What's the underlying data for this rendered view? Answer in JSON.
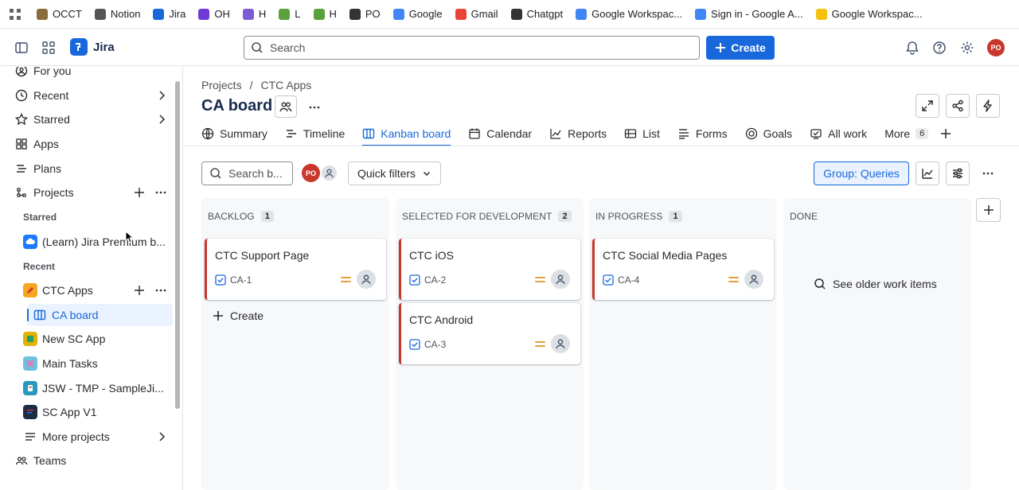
{
  "bookmarks": [
    {
      "label": "OCCT",
      "color": "#8b6a3e"
    },
    {
      "label": "Notion",
      "color": "#555555"
    },
    {
      "label": "Jira",
      "color": "#1868db"
    },
    {
      "label": "OH",
      "color": "#6f3bd6"
    },
    {
      "label": "H",
      "color": "#7b5cd6"
    },
    {
      "label": "L",
      "color": "#5aa13c"
    },
    {
      "label": "H",
      "color": "#5aa13c"
    },
    {
      "label": "PO",
      "color": "#333333"
    },
    {
      "label": "Google",
      "color": "#4285f4"
    },
    {
      "label": "Gmail",
      "color": "#ea4335"
    },
    {
      "label": "Chatgpt",
      "color": "#333333"
    },
    {
      "label": "Google Workspac...",
      "color": "#4285f4"
    },
    {
      "label": "Sign in - Google A...",
      "color": "#4285f4"
    },
    {
      "label": "Google Workspac...",
      "color": "#f4c20d"
    }
  ],
  "topnav": {
    "app_name": "Jira",
    "search_placeholder": "Search",
    "create_label": "Create",
    "user_initials": "PO"
  },
  "sidebar": {
    "for_you": "For you",
    "recent": "Recent",
    "starred": "Starred",
    "apps": "Apps",
    "plans": "Plans",
    "projects": "Projects",
    "starred_header": "Starred",
    "starred_item": "(Learn) Jira Premium b...",
    "recent_header": "Recent",
    "ctc_apps": "CTC Apps",
    "ca_board": "CA board",
    "new_sc_app": "New SC App",
    "main_tasks": "Main Tasks",
    "jsw_tmp": "JSW - TMP - SampleJi...",
    "sc_app_v1": "SC App V1",
    "more_projects": "More projects",
    "teams": "Teams"
  },
  "breadcrumbs": {
    "projects": "Projects",
    "sep": "/",
    "project": "CTC Apps"
  },
  "page_title": "CA board",
  "tabs": {
    "summary": "Summary",
    "timeline": "Timeline",
    "kanban": "Kanban board",
    "calendar": "Calendar",
    "reports": "Reports",
    "list": "List",
    "forms": "Forms",
    "goals": "Goals",
    "all_work": "All work",
    "more": "More",
    "more_count": "6"
  },
  "toolbar": {
    "search_placeholder": "Search b...",
    "quick_filters": "Quick filters",
    "group_by": "Group: Queries",
    "avatar_initials": "PO"
  },
  "columns": {
    "backlog": {
      "name": "BACKLOG",
      "count": "1",
      "create_label": "Create"
    },
    "selected": {
      "name": "SELECTED FOR DEVELOPMENT",
      "count": "2"
    },
    "in_progress": {
      "name": "IN PROGRESS",
      "count": "1"
    },
    "done": {
      "name": "DONE",
      "older_label": "See older work items"
    }
  },
  "cards": {
    "ca1": {
      "title": "CTC Support Page",
      "key": "CA-1"
    },
    "ca2": {
      "title": "CTC iOS",
      "key": "CA-2"
    },
    "ca3": {
      "title": "CTC Android",
      "key": "CA-3"
    },
    "ca4": {
      "title": "CTC Social Media Pages",
      "key": "CA-4"
    }
  },
  "colors": {
    "accent": "#1868db",
    "card_stripe": "#c9372c",
    "priority": "#e2a03f"
  }
}
